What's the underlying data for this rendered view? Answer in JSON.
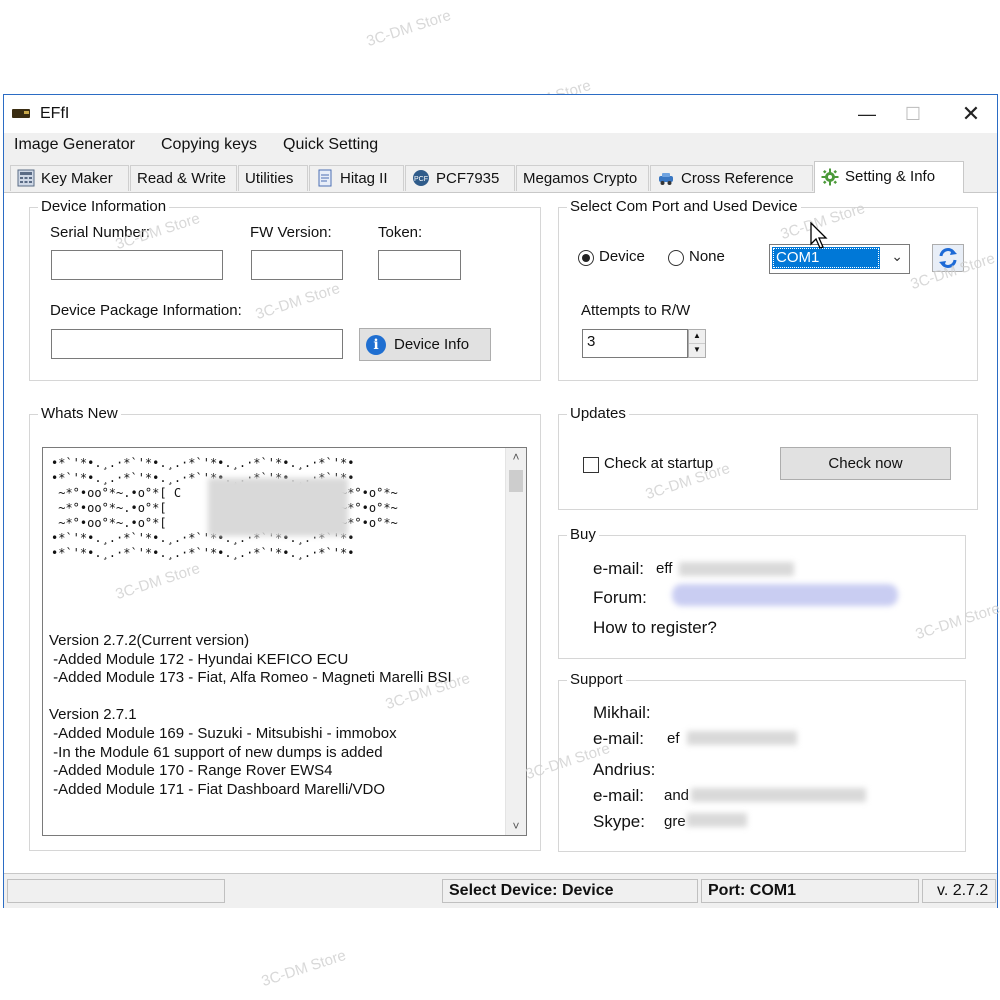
{
  "window": {
    "title": "EFfI"
  },
  "menu": [
    "Image Generator",
    "Copying keys",
    "Quick Setting"
  ],
  "tabs": [
    "Key Maker",
    "Read & Write",
    "Utilities",
    "Hitag II",
    "PCF7935",
    "Megamos Crypto",
    "Cross Reference",
    "Setting & Info"
  ],
  "device_info": {
    "group_label": "Device Information",
    "serial_label": "Serial Number:",
    "fw_label": "FW Version:",
    "token_label": "Token:",
    "package_label": "Device Package Information:",
    "device_info_button": "Device Info"
  },
  "com_port": {
    "group_label": "Select Com Port and Used Device",
    "radio_device": "Device",
    "radio_none": "None",
    "selected_port": "COM1",
    "attempts_label": "Attempts to R/W",
    "attempts_value": "3"
  },
  "whats_new": {
    "group_label": "Whats New",
    "notes": "Version 2.7.2(Current version)\n -Added Module 172 - Hyundai KEFICO ECU\n -Added Module 173 - Fiat, Alfa Romeo - Magneti Marelli BSI\n\nVersion 2.7.1\n -Added Module 169 - Suzuki - Mitsubishi - immobox\n -In the Module 61 support of new dumps is added\n -Added Module 170 - Range Rover EWS4\n -Added Module 171 - Fiat Dashboard Marelli/VDO"
  },
  "updates": {
    "group_label": "Updates",
    "check_at_startup": "Check at startup",
    "check_now_button": "Check now"
  },
  "buy": {
    "group_label": "Buy",
    "email_label": "e-mail:",
    "email_value": "eff",
    "forum_label": "Forum:",
    "register_link": "How to register?"
  },
  "support": {
    "group_label": "Support",
    "name1": "Mikhail:",
    "email_label": "e-mail:",
    "email1_value": "ef",
    "name2": "Andrius:",
    "email2_value": "and",
    "skype_label": "Skype:",
    "skype_value": "gre"
  },
  "status": {
    "select_device": "Select Device:  Device",
    "port": "Port:  COM1",
    "version": "v. 2.7.2"
  },
  "watermark": "3C-DM Store"
}
